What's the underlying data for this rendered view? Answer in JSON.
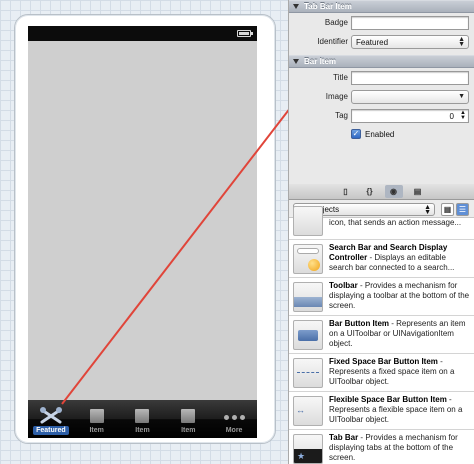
{
  "inspector": {
    "tab_bar_item_section": "Tab Bar Item",
    "badge_label": "Badge",
    "badge_value": "",
    "identifier_label": "Identifier",
    "identifier_value": "Featured",
    "bar_item_section": "Bar Item",
    "title_label": "Title",
    "title_value": "",
    "image_label": "Image",
    "image_value": "",
    "tag_label": "Tag",
    "tag_value": "0",
    "enabled_label": "Enabled",
    "enabled_checked": true
  },
  "library": {
    "tabs": [
      "file-template-icon",
      "code-snippet-icon",
      "objects-icon",
      "media-icon"
    ],
    "selector_value": "Objects",
    "items": [
      {
        "name": "",
        "desc": "icon, that sends an action message..."
      },
      {
        "name": "Search Bar and Search Display Controller",
        "desc": " - Displays an editable search bar connected to a search..."
      },
      {
        "name": "Toolbar",
        "desc": " - Provides a mechanism for displaying a toolbar at the bottom of the screen."
      },
      {
        "name": "Bar Button Item",
        "desc": " - Represents an item on a UIToolbar or UINavigationItem object."
      },
      {
        "name": "Fixed Space Bar Button Item",
        "desc": " - Represents a fixed space item on a UIToolbar object."
      },
      {
        "name": "Flexible Space Bar Button Item",
        "desc": " - Represents a flexible space item on a UIToolbar object."
      },
      {
        "name": "Tab Bar",
        "desc": " - Provides a mechanism for displaying tabs at the bottom of the screen."
      }
    ]
  },
  "tabbar": {
    "items": [
      {
        "label": "Featured",
        "icon": "tools-icon",
        "selected": true
      },
      {
        "label": "Item",
        "icon": "square-icon",
        "selected": false
      },
      {
        "label": "Item",
        "icon": "square-icon",
        "selected": false
      },
      {
        "label": "Item",
        "icon": "square-icon",
        "selected": false
      },
      {
        "label": "More",
        "icon": "more-dots-icon",
        "selected": false
      }
    ]
  },
  "colors": {
    "selected_tab": "#2d5fa8",
    "connection_line": "#e0453a",
    "checkbox": "#2f68c4"
  }
}
